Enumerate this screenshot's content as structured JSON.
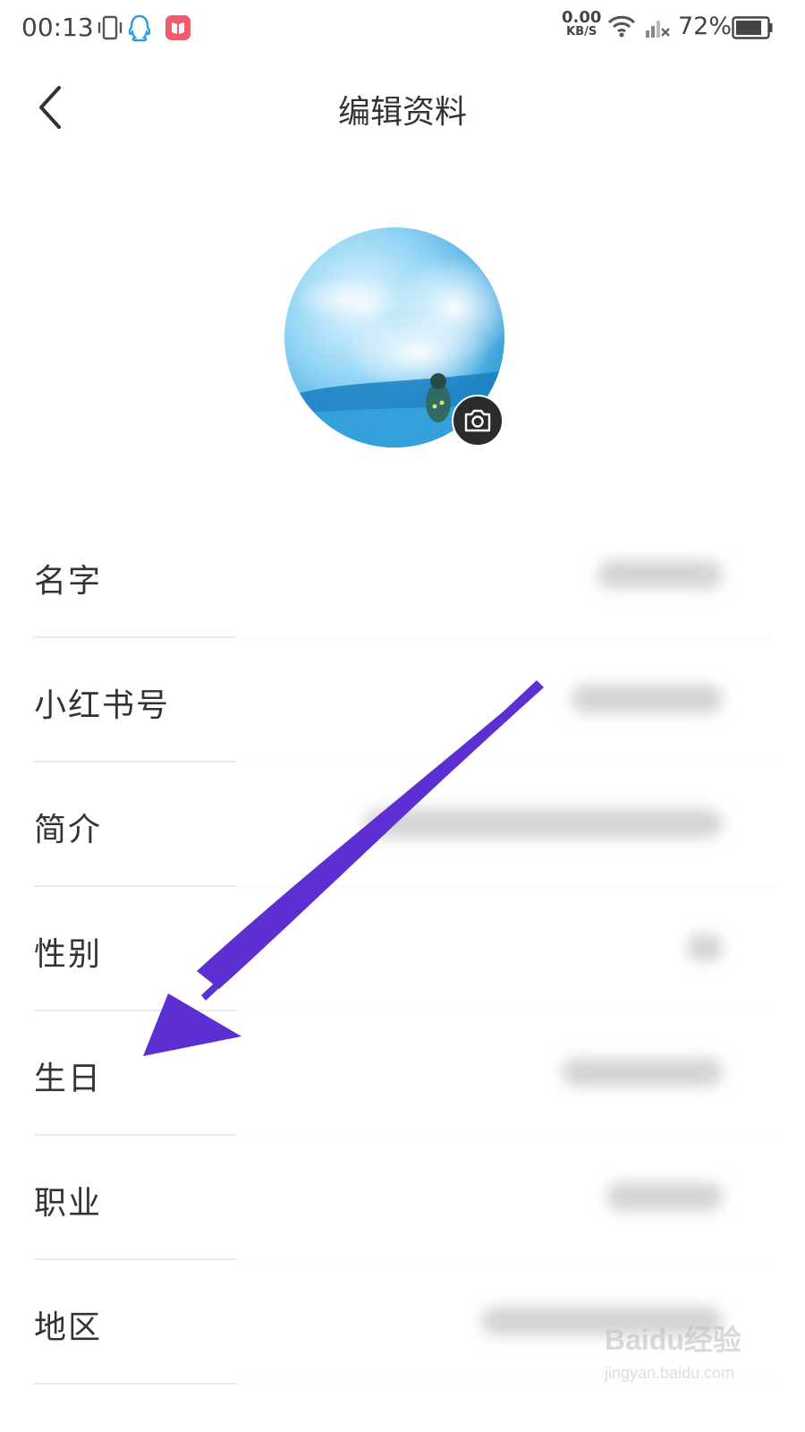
{
  "status_bar": {
    "time": "00:13",
    "network_speed_value": "0.00",
    "network_speed_unit": "KB/S",
    "battery_percent": "72%",
    "icons": [
      "vibrate-icon",
      "qq-icon",
      "book-app-icon",
      "wifi-icon",
      "signal-icon",
      "battery-icon"
    ]
  },
  "header": {
    "title": "编辑资料",
    "back_icon": "chevron-left-icon"
  },
  "avatar": {
    "camera_icon": "camera-icon"
  },
  "rows": [
    {
      "label": "名字"
    },
    {
      "label": "小红书号"
    },
    {
      "label": "简介"
    },
    {
      "label": "性别"
    },
    {
      "label": "生日"
    },
    {
      "label": "职业"
    },
    {
      "label": "地区"
    }
  ],
  "annotation": {
    "color": "#5b2fd1"
  },
  "watermark": {
    "brand": "Baidu经验",
    "site": "jingyan.baidu.com"
  }
}
